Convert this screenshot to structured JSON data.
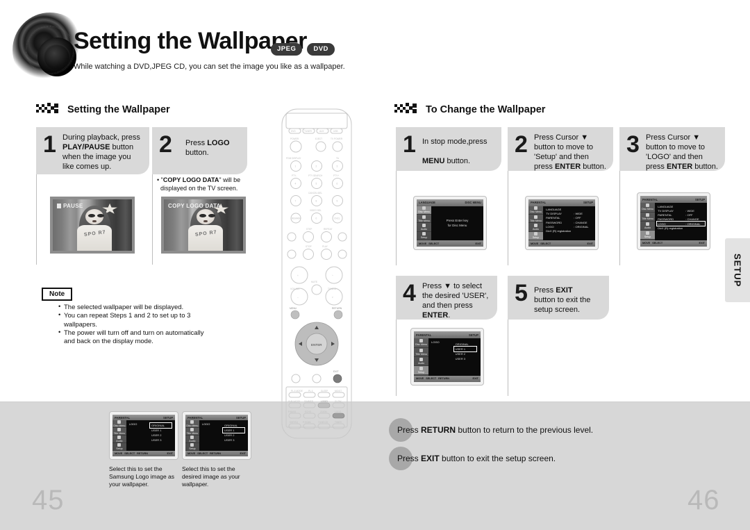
{
  "header": {
    "title": "Setting the Wallpaper",
    "badges": [
      "JPEG",
      "DVD"
    ],
    "subtitle": "While watching a DVD,JPEG CD, you can set the image you like as a wallpaper."
  },
  "left_section": {
    "heading": "Setting the Wallpaper",
    "steps": [
      {
        "num": "1",
        "line1": "During playback, press",
        "bold1": "PLAY/PAUSE",
        "line2": " button",
        "line3": "when the image you",
        "line4": "like comes up."
      },
      {
        "num": "2",
        "line1": "Press ",
        "bold1": "LOGO",
        "line2": "button."
      }
    ],
    "bullet_note": {
      "quote": "COPY LOGO DATA",
      "rest": "\" will be",
      "line2": "displayed on the TV screen."
    },
    "photo1_overlay": "PAUSE",
    "photo2_overlay": "COPY LOGO DATA",
    "photo_shirt_text": "SPO  R7"
  },
  "note": {
    "label": "Note",
    "items": [
      "The selected wallpaper will be displayed.",
      "You can repeat Steps 1 and 2 to set up to 3 wallpapers.",
      "The power will turn off and turn on automatically and back on the display mode."
    ]
  },
  "right_section": {
    "heading": "To Change the Wallpaper",
    "steps": [
      {
        "num": "1",
        "l1": "In stop mode,press",
        "l2bold": "MENU",
        "l2rest": " button."
      },
      {
        "num": "2",
        "l1": "Press Cursor ▼",
        "l2": "button to move to",
        "l3": "'Setup' and then",
        "l4pre": "press ",
        "l4bold": "ENTER",
        "l4post": " button."
      },
      {
        "num": "3",
        "l1": "Press Cursor ▼",
        "l2": "button to move to",
        "l3": "'LOGO' and then",
        "l4pre": "press ",
        "l4bold": "ENTER",
        "l4post": " button."
      },
      {
        "num": "4",
        "l1": "Press ▼ to select",
        "l2": "the desired 'USER',",
        "l3": "and then press",
        "l4bold": "ENTER",
        "l4post": "."
      },
      {
        "num": "5",
        "l1pre": "Press ",
        "l1bold": "EXIT",
        "l2": "button to exit the",
        "l3": "setup screen."
      }
    ]
  },
  "callouts": [
    {
      "pre": "Press ",
      "bold": "RETURN",
      "post": " button to return to the previous level."
    },
    {
      "pre": "Press ",
      "bold": "EXIT",
      "post": " button to exit the setup screen."
    }
  ],
  "bottom_captions": [
    "Select this to set the Samsung Logo image as your wallpaper.",
    "Select this to set the desired image as your wallpaper."
  ],
  "setup_tab": {
    "label": "SETUP"
  },
  "page_numbers": {
    "left": "45",
    "right": "46"
  },
  "tv_screens": {
    "disc_menu": {
      "topbar_left": "LANGUAGE",
      "topbar_right": "DISC MENU",
      "side": [
        "Disc Menu",
        "Title Menu",
        "Audio",
        "Setup"
      ],
      "center_line1": "Press Enter key",
      "center_line2": "for Disc Menu",
      "bottom": [
        "MOVE",
        "SELECT",
        "EXIT"
      ]
    },
    "setup_menu": {
      "topbar_left": "PARENTAL",
      "topbar_right": "SETUP",
      "side": [
        "Disc Menu",
        "Title Menu",
        "Audio",
        "Setup"
      ],
      "rows": [
        {
          "k": "LANGUAGE",
          "v": ""
        },
        {
          "k": "TV DISPLAY",
          "v": ": WIDE"
        },
        {
          "k": "PARENTAL",
          "v": ": OFF"
        },
        {
          "k": "PASSWORD",
          "v": ": CHANGE"
        },
        {
          "k": "LOGO",
          "v": ": ORIGINAL"
        },
        {
          "k": "DivX (R) registration",
          "v": ""
        }
      ],
      "bottom": [
        "MOVE",
        "SELECT",
        "EXIT"
      ]
    },
    "logo_highlight": {
      "topbar_left": "PARENTAL",
      "topbar_right": "SETUP",
      "highlight_row": "LOGO",
      "highlight_value": ": ORIGINAL"
    },
    "logo_options": {
      "topbar_left": "PARENTAL",
      "topbar_right": "SETUP",
      "label": "LOGO",
      "options": [
        "ORIGINAL",
        "USER 1",
        "USER 2",
        "USER 3"
      ],
      "selected": "USER 1",
      "bottom": [
        "MOVE",
        "SELECT",
        "RETURN",
        "EXIT"
      ]
    },
    "thumb_left": {
      "label": "LOGO",
      "options": [
        "ORIGINAL",
        "USER 1",
        "USER 2",
        "USER 3"
      ],
      "selected": "ORIGINAL"
    },
    "thumb_right": {
      "label": "LOGO",
      "options": [
        "ORIGINAL",
        "USER 1",
        "USER 2",
        "USER 3"
      ],
      "selected": "USER 1"
    }
  },
  "remote": {
    "top_buttons": [
      "DVD",
      "TUNER",
      "AUX",
      "USB"
    ],
    "labels": {
      "power": "POWER",
      "eject": "EJECT",
      "tv_power": "TV POWER",
      "pgm_display": "PGM DISPLAY",
      "ta": "TA",
      "ptyminus": "PTY-",
      "pty_search": "PTY SEARCH",
      "ptyplus": "PTY+",
      "cancel_del": "CANCEL/DEL",
      "video_sel": "VIDEO SEL",
      "step": "STEP",
      "repeat": "REPEAT",
      "stop": "STOP",
      "play": "PLAY",
      "volume": "VOLUME",
      "mute": "MUTE",
      "tuning": "TUNING",
      "menu": "MENU",
      "return": "RETURN",
      "enter": "ENTER",
      "exit": "EXIT",
      "logo": "LOGO",
      "slow": "SLOW",
      "zoom": "ZOOM",
      "timer": "TIMER"
    }
  }
}
